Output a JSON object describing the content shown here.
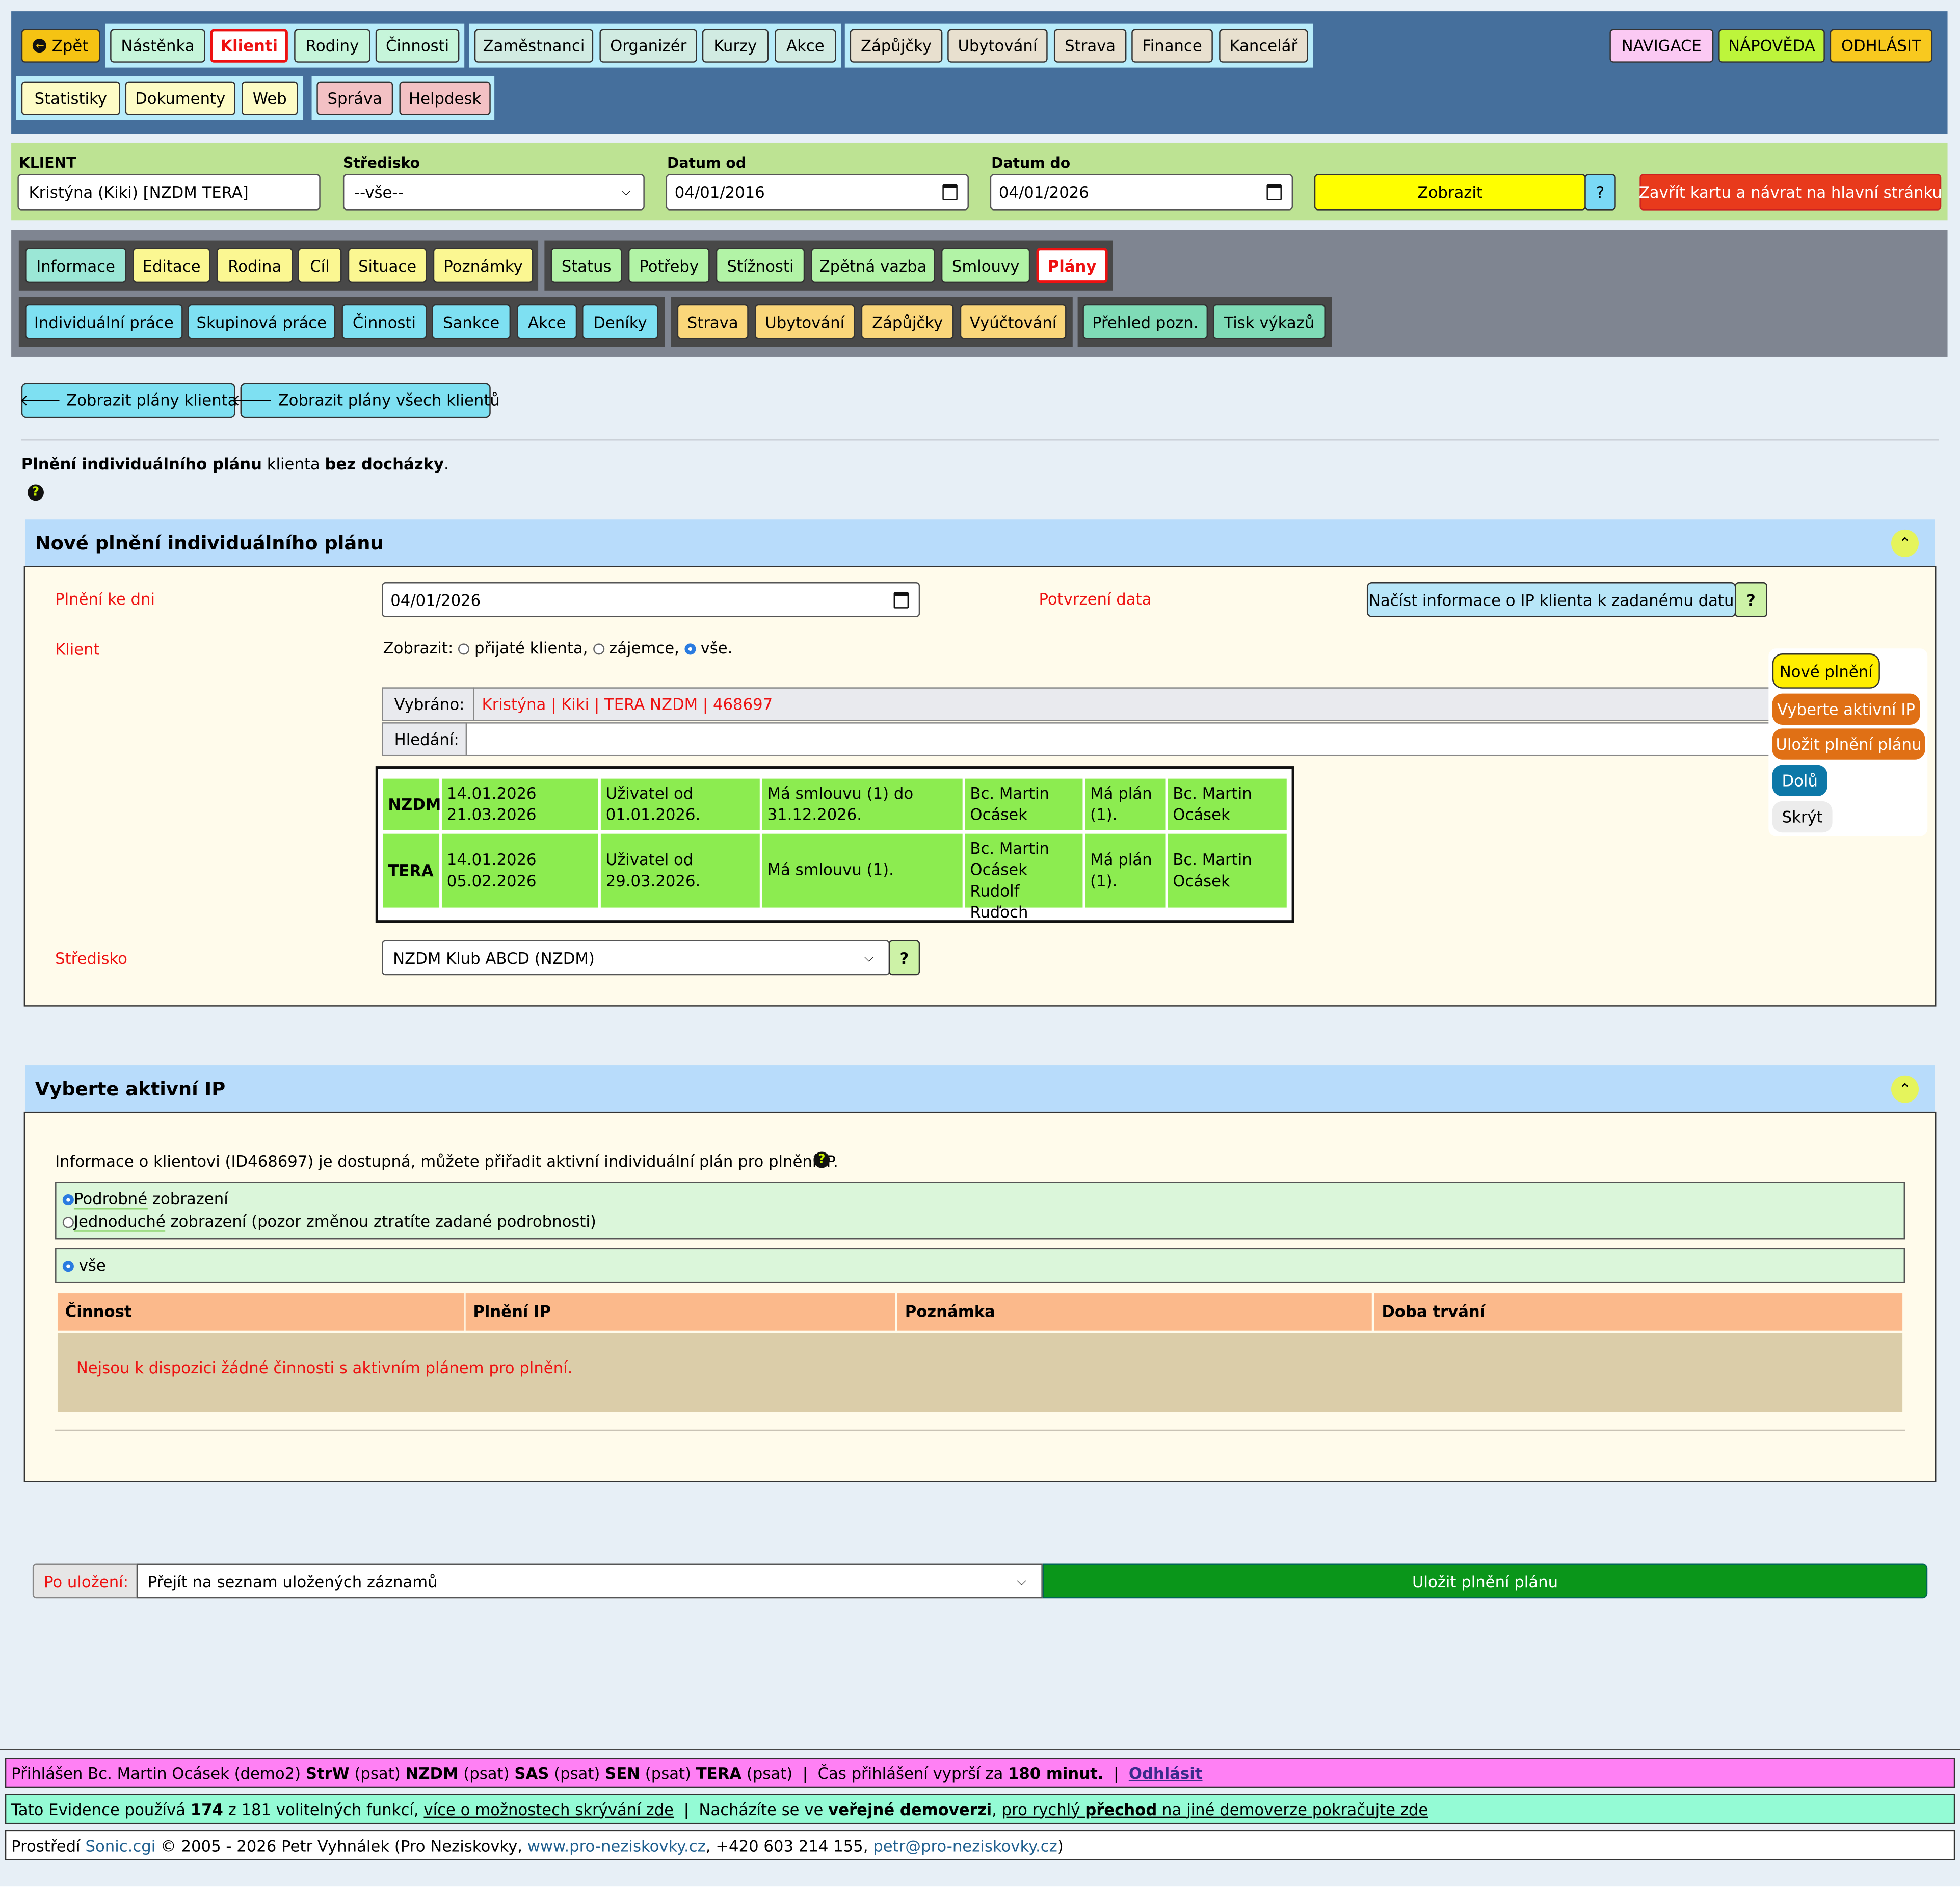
{
  "nav": {
    "back": "Zpět",
    "row1": [
      "Nástěnka",
      "Klienti",
      "Rodiny",
      "Činnosti",
      "Zaměstnanci",
      "Organizér",
      "Kurzy",
      "Akce",
      "Zápůjčky",
      "Ubytování",
      "Strava",
      "Finance",
      "Kancelář"
    ],
    "row2": [
      "Statistiky",
      "Dokumenty",
      "Web",
      "Správa",
      "Helpdesk"
    ],
    "right": [
      "NAVIGACE",
      "NÁPOVĚDA",
      "ODHLÁSIT"
    ]
  },
  "filter": {
    "client_label": "KLIENT",
    "client_value": "Kristýna (Kiki) [NZDM TERA]",
    "center_label": "Středisko",
    "center_value": "--vše--",
    "from_label": "Datum od",
    "from_value": "04/01/2016",
    "to_label": "Datum do",
    "to_value": "04/01/2026",
    "show_button": "Zobrazit",
    "help_button": "?",
    "close_button": "Zavřít kartu a návrat na hlavní stránku"
  },
  "tabs": {
    "row1": [
      "Informace",
      "Editace",
      "Rodina",
      "Cíl",
      "Situace",
      "Poznámky",
      "Status",
      "Potřeby",
      "Stížnosti",
      "Zpětná vazba",
      "Smlouvy",
      "Plány"
    ],
    "row2": [
      "Individuální práce",
      "Skupinová práce",
      "Činnosti",
      "Sankce",
      "Akce",
      "Deníky",
      "Strava",
      "Ubytování",
      "Zápůjčky",
      "Vyúčtování",
      "Přehled pozn.",
      "Tisk výkazů"
    ]
  },
  "actions": {
    "show_client_plans": "🡐 Zobrazit plány klienta",
    "show_all_plans": "🡐 Zobrazit plány všech klientů"
  },
  "intro": {
    "part1": "Plnění individuálního plánu",
    "part2": " klienta ",
    "part3": "bez docházky",
    "part4": "."
  },
  "section1": {
    "title": "Nové plnění individuálního plánu",
    "date_label": "Plnění ke dni",
    "date_value": "04/01/2026",
    "confirm_label": "Potvrzení data",
    "load_button": "Načíst informace o IP klienta k zadanému datu",
    "load_help": "?",
    "client_label": "Klient",
    "show_prefix": "Zobrazit:",
    "opt1": "přijaté klienta,",
    "opt2": "zájemce,",
    "opt3": "vše.",
    "selected_label": "Vybráno:",
    "selected_value": "Kristýna | Kiki | TERA NZDM | 468697",
    "search_label": "Hledání:",
    "rows": [
      {
        "code": "NZDM",
        "dates": "14.01.2026\n21.03.2026",
        "user": "Uživatel od\n01.01.2026.",
        "contract": "Má smlouvu (1) do\n31.12.2026.",
        "worker": "Bc. Martin\nOcásek",
        "plan": "Má plán\n(1).",
        "plan_worker": "Bc. Martin\nOcásek"
      },
      {
        "code": "TERA",
        "dates": "14.01.2026\n05.02.2026",
        "user": "Uživatel od\n29.03.2026.",
        "contract": "Má smlouvu (1).",
        "worker": "Bc. Martin\nOcásek\nRudolf Ruďoch",
        "plan": "Má plán\n(1).",
        "plan_worker": "Bc. Martin\nOcásek"
      }
    ],
    "center_label": "Středisko",
    "center_value": "NZDM Klub ABCD (NZDM)",
    "center_help": "?"
  },
  "floating": [
    "Nové plnění",
    "Vyberte aktivní IP",
    "Uložit plnění plánu",
    "Dolů",
    "Skrýt"
  ],
  "section2": {
    "title": "Vyberte aktivní IP",
    "info": "Informace o klientovi (ID468697) je dostupná, můžete přiřadit aktivní individuální plán pro plnění IP.",
    "view_detail_a": "Podrobné",
    "view_detail_b": " zobrazení",
    "view_simple_a": "Jednoduché",
    "view_simple_b": " zobrazení (pozor změnou ztratíte zadané podrobnosti)",
    "filter_all": "vše",
    "columns": [
      "Činnost",
      "Plnění IP",
      "Poznámka",
      "Doba trvání"
    ],
    "empty": "Nejsou k dispozici žádné činnosti s aktivním plánem pro plnění."
  },
  "save": {
    "after_label": "Po uložení:",
    "after_value": "Přejít na seznam uložených záznamů",
    "button": "Uložit plnění plánu"
  },
  "footer": {
    "login_prefix": "Přihlášen Bc. Martin Ocásek (demo2) ",
    "r1": "StrW",
    "p1": " (psat) ",
    "r2": "NZDM",
    "p2": " (psat) ",
    "r3": "SAS",
    "p3": " (psat) ",
    "r4": "SEN",
    "p4": " (psat) ",
    "r5": "TERA",
    "p5": " (psat)  |  Čas přihlášení vyprší za ",
    "minutes": "180 minut.",
    "sep": "  |  ",
    "logout": "Odhlásit",
    "feat_prefix": "Tato Evidence používá ",
    "feat_count": "174",
    "feat_mid": " z 181 volitelných funkcí, ",
    "feat_link": "více o možnostech skrývání zde",
    "feat_sep": "  |  Nacházíte se ve ",
    "feat_demo": "veřejné demoverzi",
    "feat_comma": ", ",
    "feat_link2a": "pro rychlý ",
    "feat_link2b": "přechod",
    "feat_link2c": " na jiné demoverze pokračujte zde",
    "copy_prefix": "Prostředí ",
    "copy_env": "Sonic.cgi",
    "copy_mid": " © 2005 - 2026 Petr Vyhnálek (Pro Neziskovky, ",
    "copy_web": "www.pro-neziskovky.cz",
    "copy_phone": ", +420 603 214 155, ",
    "copy_mail": "petr@pro-neziskovky.cz",
    "copy_end": ")"
  },
  "colors": {
    "header_bg": "#456f9c",
    "filter_bg": "#bde393",
    "tabs_bg": "#7f8591",
    "accent_red": "#e11111",
    "save_green": "#0a961a"
  }
}
